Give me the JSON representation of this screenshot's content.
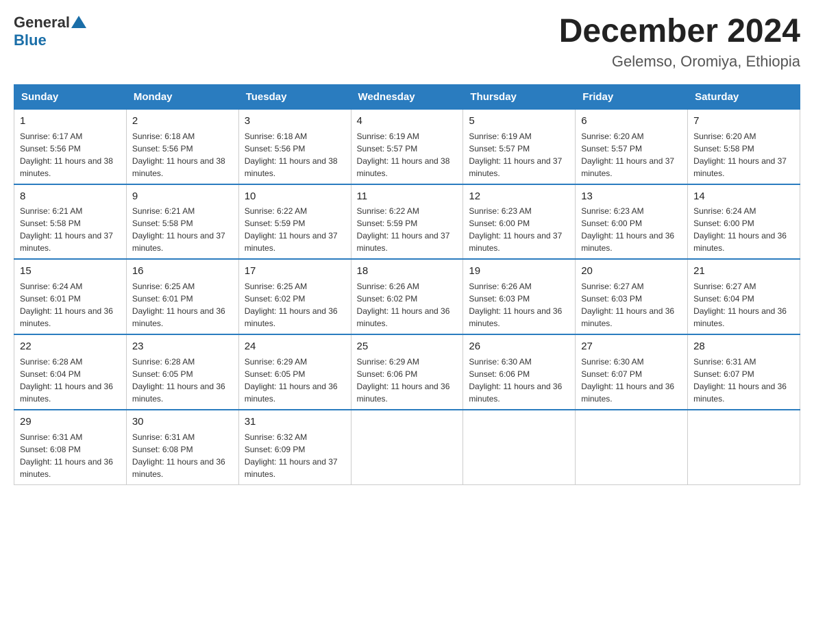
{
  "logo": {
    "general": "General",
    "blue": "Blue"
  },
  "title": "December 2024",
  "subtitle": "Gelemso, Oromiya, Ethiopia",
  "headers": [
    "Sunday",
    "Monday",
    "Tuesday",
    "Wednesday",
    "Thursday",
    "Friday",
    "Saturday"
  ],
  "weeks": [
    [
      {
        "day": "1",
        "sunrise": "6:17 AM",
        "sunset": "5:56 PM",
        "daylight": "11 hours and 38 minutes."
      },
      {
        "day": "2",
        "sunrise": "6:18 AM",
        "sunset": "5:56 PM",
        "daylight": "11 hours and 38 minutes."
      },
      {
        "day": "3",
        "sunrise": "6:18 AM",
        "sunset": "5:56 PM",
        "daylight": "11 hours and 38 minutes."
      },
      {
        "day": "4",
        "sunrise": "6:19 AM",
        "sunset": "5:57 PM",
        "daylight": "11 hours and 38 minutes."
      },
      {
        "day": "5",
        "sunrise": "6:19 AM",
        "sunset": "5:57 PM",
        "daylight": "11 hours and 37 minutes."
      },
      {
        "day": "6",
        "sunrise": "6:20 AM",
        "sunset": "5:57 PM",
        "daylight": "11 hours and 37 minutes."
      },
      {
        "day": "7",
        "sunrise": "6:20 AM",
        "sunset": "5:58 PM",
        "daylight": "11 hours and 37 minutes."
      }
    ],
    [
      {
        "day": "8",
        "sunrise": "6:21 AM",
        "sunset": "5:58 PM",
        "daylight": "11 hours and 37 minutes."
      },
      {
        "day": "9",
        "sunrise": "6:21 AM",
        "sunset": "5:58 PM",
        "daylight": "11 hours and 37 minutes."
      },
      {
        "day": "10",
        "sunrise": "6:22 AM",
        "sunset": "5:59 PM",
        "daylight": "11 hours and 37 minutes."
      },
      {
        "day": "11",
        "sunrise": "6:22 AM",
        "sunset": "5:59 PM",
        "daylight": "11 hours and 37 minutes."
      },
      {
        "day": "12",
        "sunrise": "6:23 AM",
        "sunset": "6:00 PM",
        "daylight": "11 hours and 37 minutes."
      },
      {
        "day": "13",
        "sunrise": "6:23 AM",
        "sunset": "6:00 PM",
        "daylight": "11 hours and 36 minutes."
      },
      {
        "day": "14",
        "sunrise": "6:24 AM",
        "sunset": "6:00 PM",
        "daylight": "11 hours and 36 minutes."
      }
    ],
    [
      {
        "day": "15",
        "sunrise": "6:24 AM",
        "sunset": "6:01 PM",
        "daylight": "11 hours and 36 minutes."
      },
      {
        "day": "16",
        "sunrise": "6:25 AM",
        "sunset": "6:01 PM",
        "daylight": "11 hours and 36 minutes."
      },
      {
        "day": "17",
        "sunrise": "6:25 AM",
        "sunset": "6:02 PM",
        "daylight": "11 hours and 36 minutes."
      },
      {
        "day": "18",
        "sunrise": "6:26 AM",
        "sunset": "6:02 PM",
        "daylight": "11 hours and 36 minutes."
      },
      {
        "day": "19",
        "sunrise": "6:26 AM",
        "sunset": "6:03 PM",
        "daylight": "11 hours and 36 minutes."
      },
      {
        "day": "20",
        "sunrise": "6:27 AM",
        "sunset": "6:03 PM",
        "daylight": "11 hours and 36 minutes."
      },
      {
        "day": "21",
        "sunrise": "6:27 AM",
        "sunset": "6:04 PM",
        "daylight": "11 hours and 36 minutes."
      }
    ],
    [
      {
        "day": "22",
        "sunrise": "6:28 AM",
        "sunset": "6:04 PM",
        "daylight": "11 hours and 36 minutes."
      },
      {
        "day": "23",
        "sunrise": "6:28 AM",
        "sunset": "6:05 PM",
        "daylight": "11 hours and 36 minutes."
      },
      {
        "day": "24",
        "sunrise": "6:29 AM",
        "sunset": "6:05 PM",
        "daylight": "11 hours and 36 minutes."
      },
      {
        "day": "25",
        "sunrise": "6:29 AM",
        "sunset": "6:06 PM",
        "daylight": "11 hours and 36 minutes."
      },
      {
        "day": "26",
        "sunrise": "6:30 AM",
        "sunset": "6:06 PM",
        "daylight": "11 hours and 36 minutes."
      },
      {
        "day": "27",
        "sunrise": "6:30 AM",
        "sunset": "6:07 PM",
        "daylight": "11 hours and 36 minutes."
      },
      {
        "day": "28",
        "sunrise": "6:31 AM",
        "sunset": "6:07 PM",
        "daylight": "11 hours and 36 minutes."
      }
    ],
    [
      {
        "day": "29",
        "sunrise": "6:31 AM",
        "sunset": "6:08 PM",
        "daylight": "11 hours and 36 minutes."
      },
      {
        "day": "30",
        "sunrise": "6:31 AM",
        "sunset": "6:08 PM",
        "daylight": "11 hours and 36 minutes."
      },
      {
        "day": "31",
        "sunrise": "6:32 AM",
        "sunset": "6:09 PM",
        "daylight": "11 hours and 37 minutes."
      },
      null,
      null,
      null,
      null
    ]
  ]
}
